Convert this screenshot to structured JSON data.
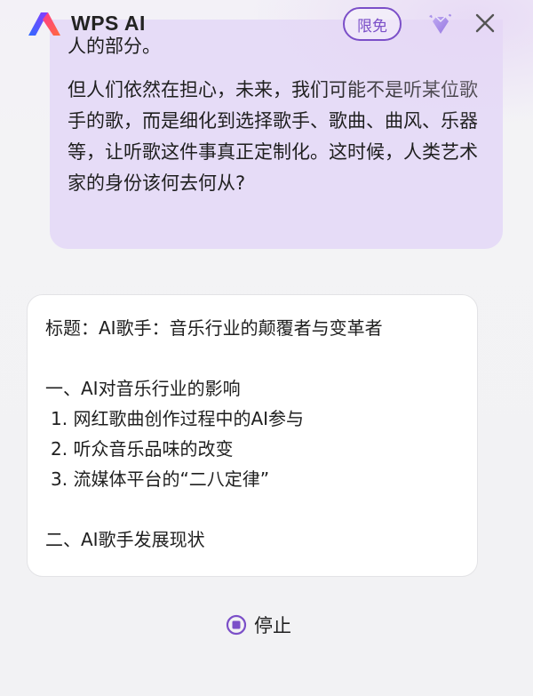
{
  "header": {
    "app_title": "WPS AI",
    "badge_label": "限免",
    "icons": [
      "wps-ai-logo-icon",
      "gem-icon",
      "close-icon"
    ]
  },
  "user_message": {
    "cut_off_line": "人的部分。",
    "paragraph": "但人们依然在担心，未来，我们可能不是听某位歌手的歌，而是细化到选择歌手、歌曲、曲风、乐器等，让听歌这件事真正定制化。这时候，人类艺术家的身份该何去何从?"
  },
  "ai_response": {
    "title": "标题：AI歌手：音乐行业的颠覆者与变革者",
    "section1_heading": "一、AI对音乐行业的影响",
    "section1_items": [
      "1. 网红歌曲创作过程中的AI参与",
      "2. 听众音乐品味的改变",
      "3. 流媒体平台的“二八定律”"
    ],
    "section2_heading": "二、AI歌手发展现状"
  },
  "controls": {
    "stop_label": "停止"
  },
  "colors": {
    "accent": "#7b4fc8",
    "user_bubble": "#e6dcf7",
    "card_bg": "#ffffff",
    "page_bg": "#f2f2f4"
  }
}
